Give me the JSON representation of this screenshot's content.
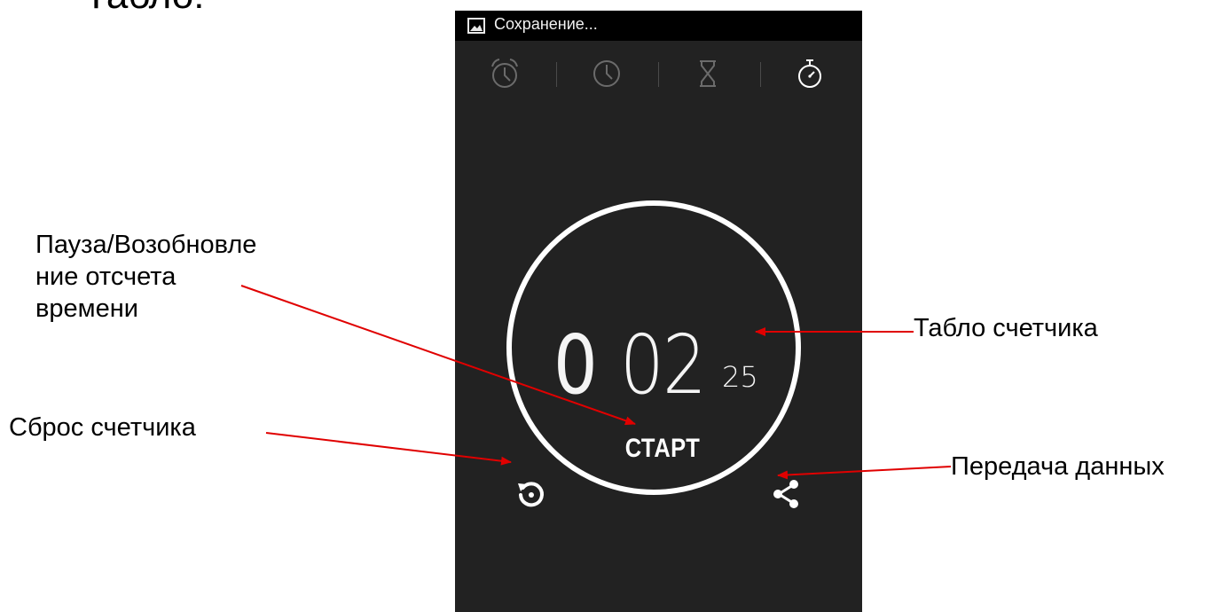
{
  "top_fragment": "Табло:",
  "status_bar": {
    "text": "Сохранение...",
    "icon": "image-icon"
  },
  "tabs": [
    {
      "name": "alarm",
      "icon": "alarm-clock-icon",
      "active": false
    },
    {
      "name": "clock",
      "icon": "clock-icon",
      "active": false
    },
    {
      "name": "timer",
      "icon": "hourglass-icon",
      "active": false
    },
    {
      "name": "stopwatch",
      "icon": "stopwatch-icon",
      "active": true
    }
  ],
  "stopwatch": {
    "minutes": "0",
    "seconds": "02",
    "hundredths": "25",
    "start_label": "СТАРТ",
    "reset_icon": "reset-icon",
    "share_icon": "share-icon"
  },
  "callouts": {
    "pause_resume": {
      "line1": "Пауза/Возобновле",
      "line2": "ние отсчета",
      "line3": "времени"
    },
    "reset": "Сброс счетчика",
    "display": "Табло счетчика",
    "share": "Передача данных"
  },
  "colors": {
    "screen_bg": "#222222",
    "status_bar_bg": "#000000",
    "inactive_icon": "#6b6b6b",
    "active_icon": "#ffffff",
    "arrow": "#e00000"
  }
}
